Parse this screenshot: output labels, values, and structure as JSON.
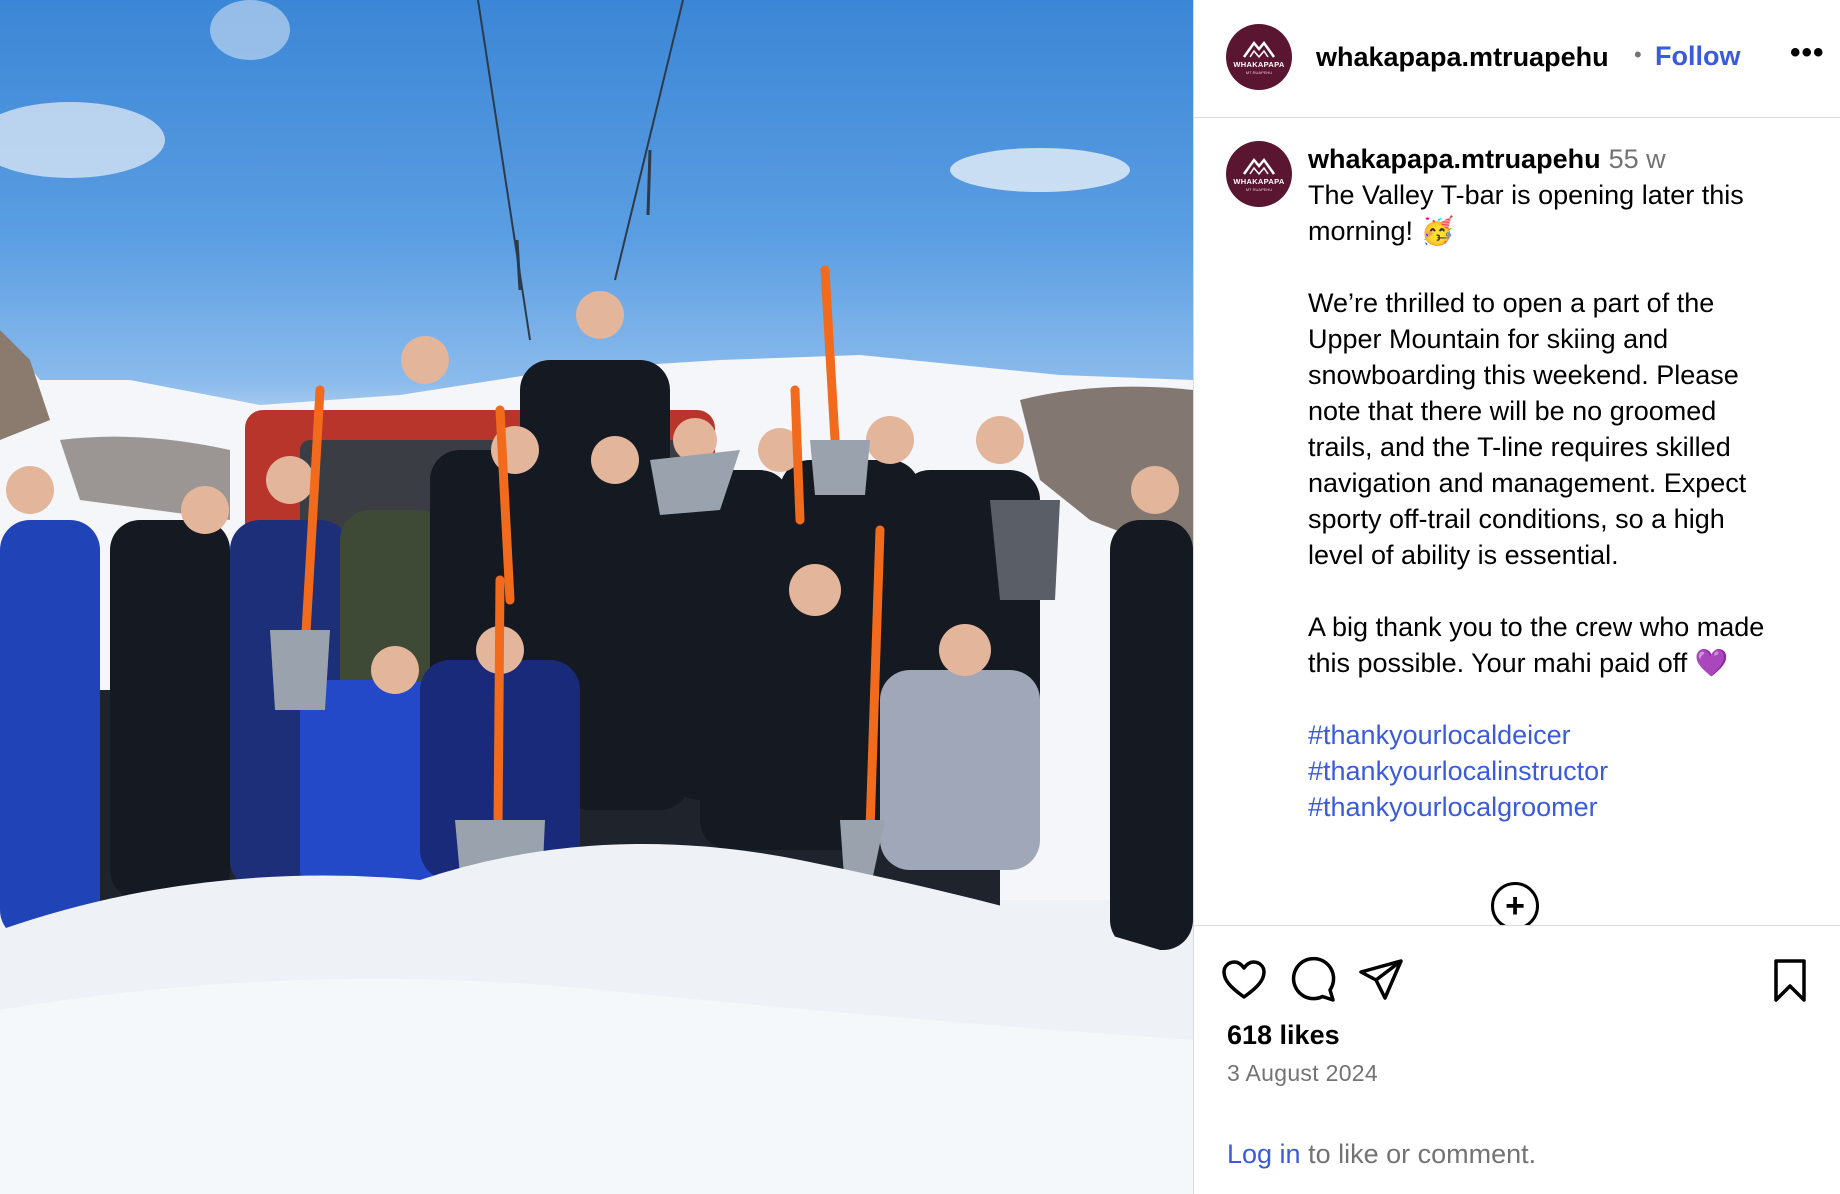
{
  "post": {
    "image_alt_subject": "crew-photo",
    "account": "whakapapa.mtruapehu",
    "follow_label": "Follow",
    "header_separator": "•",
    "more_label": "•••",
    "avatar_brand": "WHAKAPAPA",
    "avatar_sub": "MT RUAPEHU"
  },
  "caption": {
    "username": "whakapapa.mtruapehu",
    "age": "55 w",
    "lines_p1": [
      "The Valley T-bar is opening later this",
      "morning!"
    ],
    "lines_p2": [
      "We’re thrilled to open a part of the",
      "Upper Mountain for skiing and",
      "snowboarding this weekend. Please",
      "note that there will be no groomed",
      "trails, and the T-line requires skilled",
      "navigation and management. Expect",
      "sporty off-trail conditions, so a high",
      "level of ability is essential."
    ],
    "lines_p3": [
      "A big thank you to the crew who made",
      "this possible. Your mahi paid off"
    ],
    "hashtags": [
      "#thankyourlocaldeicer",
      "#thankyourlocalinstructor",
      "#thankyourlocalgroomer"
    ],
    "emoji_party": "🥳",
    "emoji_heart": "💜"
  },
  "load_more_symbol": "+",
  "actions": {
    "icons": [
      "heart-icon",
      "comment-icon",
      "share-icon",
      "bookmark-icon"
    ],
    "likes": "618 likes",
    "date": "3 August 2024",
    "login_link": "Log in",
    "login_rest": " to like or comment."
  },
  "colors": {
    "link_blue": "#3a5bdc",
    "avatar_maroon": "#5a1631",
    "muted_gray": "#737373",
    "divider": "#dbdbdb"
  }
}
